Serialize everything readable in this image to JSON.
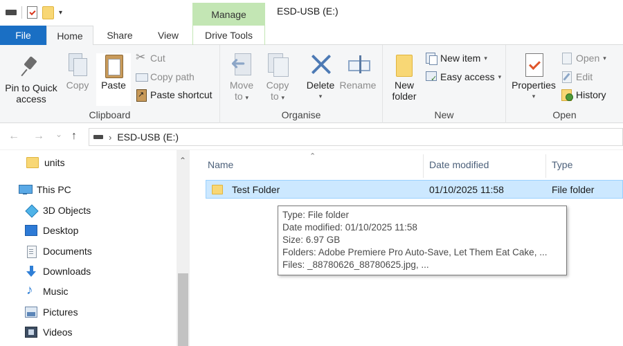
{
  "titlebar": {
    "manage_label": "Manage",
    "window_title": "ESD-USB (E:)",
    "qat_dropdown_glyph": "▾"
  },
  "tabs": [
    {
      "label": "File"
    },
    {
      "label": "Home"
    },
    {
      "label": "Share"
    },
    {
      "label": "View"
    },
    {
      "label": "Drive Tools"
    }
  ],
  "ribbon": {
    "clipboard": {
      "pin_line1": "Pin to Quick",
      "pin_line2": "access",
      "copy": "Copy",
      "paste": "Paste",
      "cut": "Cut",
      "copy_path": "Copy path",
      "paste_shortcut": "Paste shortcut",
      "group_label": "Clipboard"
    },
    "organise": {
      "move_line1": "Move",
      "move_line2": "to",
      "copy_line1": "Copy",
      "copy_line2": "to",
      "delete": "Delete",
      "rename": "Rename",
      "group_label": "Organise"
    },
    "new": {
      "new_folder_line1": "New",
      "new_folder_line2": "folder",
      "new_item": "New item",
      "easy_access": "Easy access",
      "group_label": "New"
    },
    "open": {
      "properties": "Properties",
      "open": "Open",
      "edit": "Edit",
      "history": "History",
      "group_label": "Open"
    }
  },
  "address": {
    "back_glyph": "←",
    "forward_glyph": "→",
    "recent_glyph": "⌄",
    "up_glyph": "↑",
    "separator": "›",
    "path": "ESD-USB (E:)"
  },
  "nav": {
    "items": [
      {
        "label": "units",
        "icon": "folder-icon"
      },
      {
        "label": "This PC",
        "icon": "this-pc-icon"
      },
      {
        "label": "3D Objects",
        "icon": "3d-objects-icon"
      },
      {
        "label": "Desktop",
        "icon": "desktop-icon"
      },
      {
        "label": "Documents",
        "icon": "documents-icon"
      },
      {
        "label": "Downloads",
        "icon": "downloads-icon"
      },
      {
        "label": "Music",
        "icon": "music-icon"
      },
      {
        "label": "Pictures",
        "icon": "pictures-icon"
      },
      {
        "label": "Videos",
        "icon": "videos-icon"
      }
    ],
    "scroll_up_glyph": "⌃"
  },
  "content": {
    "sort_glyph": "⌃",
    "columns": [
      "Name",
      "Date modified",
      "Type"
    ],
    "rows": [
      {
        "name": "Test Folder",
        "date_modified": "01/10/2025 11:58",
        "type": "File folder"
      }
    ]
  },
  "tooltip": {
    "lines": [
      "Type: File folder",
      "Date modified: 01/10/2025 11:58",
      "Size: 6.97 GB",
      "Folders: Adobe Premiere Pro Auto-Save, Let Them Eat Cake, ...",
      "Files: _88780626_88780625.jpg, ..."
    ]
  },
  "colors": {
    "file_tab": "#1a6fc4",
    "manage_tab": "#c3e6b4",
    "selection": "#cce8ff",
    "folder": "#f8d775"
  }
}
